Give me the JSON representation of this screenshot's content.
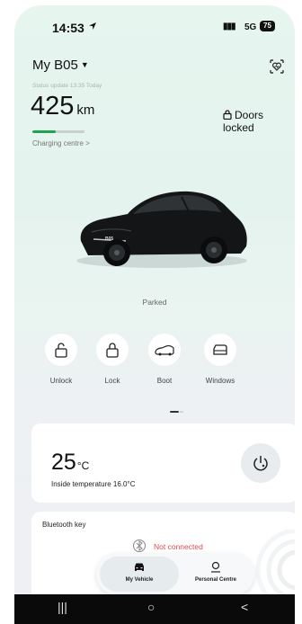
{
  "status_bar": {
    "time": "14:53",
    "network": "5G",
    "battery": "75"
  },
  "header": {
    "vehicle_name": "My B05",
    "status_update": "Status update 13:35 Today",
    "range_value": "425",
    "range_unit": "km",
    "range_level_percent": 45,
    "charging_link": "Charging centre >",
    "doors_status": "Doors locked"
  },
  "car": {
    "plate_text": "B05",
    "state": "Parked"
  },
  "actions": [
    {
      "label": "Unlock",
      "icon": "unlock-icon"
    },
    {
      "label": "Lock",
      "icon": "lock-icon"
    },
    {
      "label": "Boot",
      "icon": "boot-icon"
    },
    {
      "label": "Windows",
      "icon": "window-icon"
    }
  ],
  "climate": {
    "temperature": "25",
    "unit": "°C",
    "inside_temperature": "Inside temperature 16.0°C"
  },
  "bluetooth": {
    "title": "Bluetooth key",
    "status": "Not connected"
  },
  "tabs": [
    {
      "label": "My Vehicle",
      "icon": "car-icon",
      "active": true
    },
    {
      "label": "Personal Centre",
      "icon": "person-icon",
      "active": false
    }
  ],
  "colors": {
    "accent_green": "#21a451",
    "error_red": "#e5484d",
    "background_mint": "#e7f5ef"
  }
}
